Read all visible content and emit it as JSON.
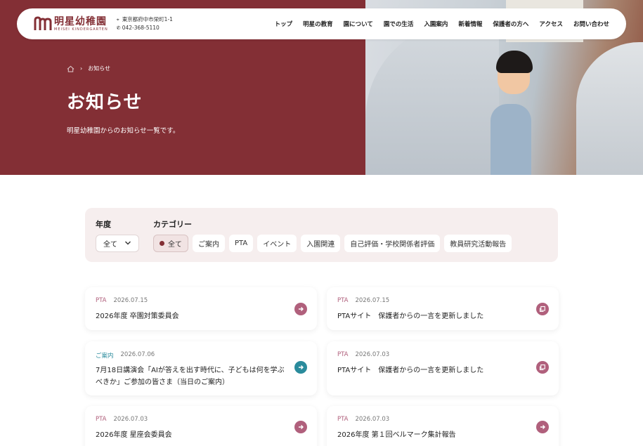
{
  "header": {
    "logo_name": "明星幼稚園",
    "logo_sub": "MEISEI KINDERGARTEN",
    "address": "東京都府中市栄町1-1",
    "phone": "042-368-5110",
    "nav": [
      "トップ",
      "明星の教育",
      "園について",
      "園での生活",
      "入園案内",
      "新着情報",
      "保護者の方へ",
      "アクセス",
      "お問い合わせ"
    ]
  },
  "hero": {
    "breadcrumb_current": "お知らせ",
    "title": "お知らせ",
    "description": "明星幼稚園からのお知らせ一覧です。"
  },
  "filter": {
    "year_label": "年度",
    "year_value": "全て",
    "category_label": "カテゴリー",
    "categories": [
      "全て",
      "ご案内",
      "PTA",
      "イベント",
      "入園関連",
      "自己評価・学校関係者評価",
      "教員研究活動報告"
    ]
  },
  "news": [
    {
      "category": "PTA",
      "date": "2026.07.15",
      "title": "2026年度 卒園対策委員会",
      "icon": "arrow-right-icon"
    },
    {
      "category": "PTA",
      "date": "2026.07.15",
      "title": "PTAサイト　保護者からの一言を更新しました",
      "icon": "external-link-icon"
    },
    {
      "category": "ご案内",
      "date": "2026.07.06",
      "title": "7月18日講演会「AIが答えを出す時代に、子どもは何を学ぶべきか」ご参加の皆さま（当日のご案内）",
      "icon": "arrow-right-icon"
    },
    {
      "category": "PTA",
      "date": "2026.07.03",
      "title": "PTAサイト　保護者からの一言を更新しました",
      "icon": "external-link-icon"
    },
    {
      "category": "PTA",
      "date": "2026.07.03",
      "title": "2026年度 星座会委員会",
      "icon": "arrow-right-icon"
    },
    {
      "category": "PTA",
      "date": "2026.07.03",
      "title": "2026年度 第１回ベルマーク集計報告",
      "icon": "arrow-right-icon"
    }
  ],
  "colors": {
    "brand": "#832f35",
    "pta": "#b0607c",
    "info": "#2a8b9c"
  }
}
